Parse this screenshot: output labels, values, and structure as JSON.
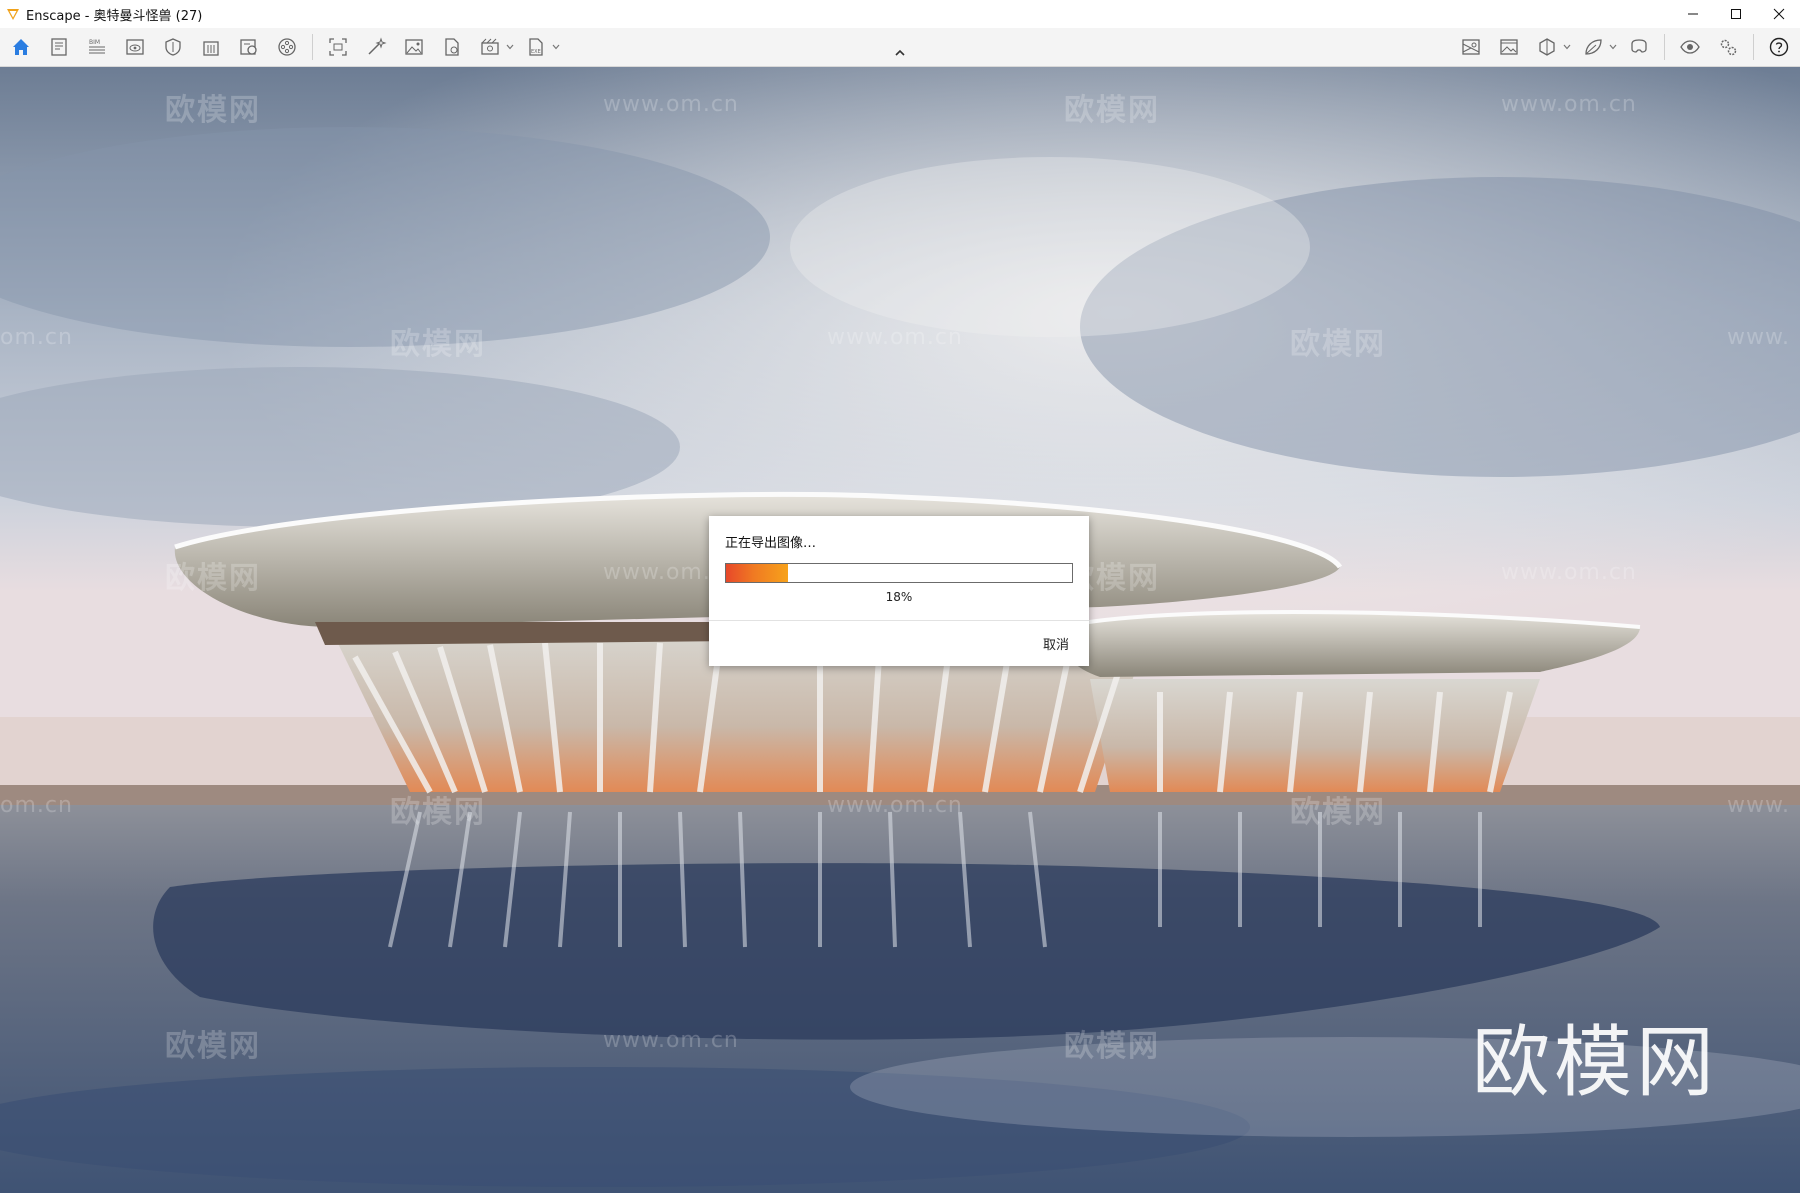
{
  "window": {
    "app_name": "Enscape",
    "title": "Enscape - 奥特曼斗怪兽 (27)",
    "controls": [
      "minimize-icon",
      "maximize-icon",
      "close-icon"
    ]
  },
  "toolbar": {
    "left_icons": [
      "home-icon",
      "document-icon",
      "bim-icon",
      "view-icon",
      "shield-icon",
      "building-icon",
      "media-icon",
      "video-reel-icon",
      "capture-icon",
      "magic-wand-icon",
      "image-icon",
      "file-export-icon",
      "batch-render-icon",
      "exe-export-icon"
    ],
    "right_icons": [
      "map-view-icon",
      "image-gallery-icon",
      "cube-view-icon",
      "leaf-asset-icon",
      "vr-headset-icon",
      "eye-icon",
      "settings-gears-icon",
      "help-icon"
    ],
    "active": "home-icon"
  },
  "dialog": {
    "title": "正在导出图像…",
    "progress": 18,
    "progress_label": "18%",
    "cancel_label": "取消"
  },
  "watermarks": {
    "brand": "欧模网",
    "url": "www.om.cn",
    "url_partial": "om.cn",
    "url_partial_right": "www."
  },
  "colors": {
    "accent": "#2a7de1",
    "progress_start": "#e7482a",
    "progress_end": "#f7a21b"
  }
}
